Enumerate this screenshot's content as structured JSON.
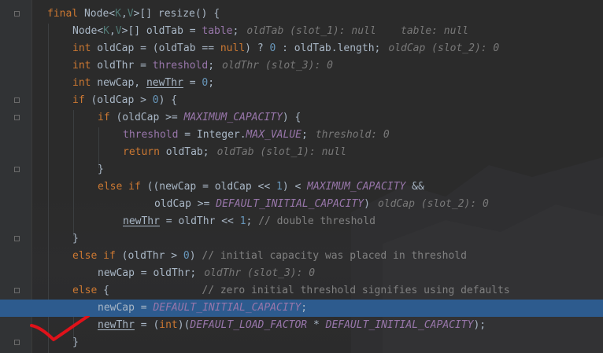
{
  "code_lines": [
    {
      "text": "final Node<K,V>[] resize() {"
    },
    {
      "text": "Node<K,V>[] oldTab = table;",
      "hint": "oldTab (slot_1): null    table: null"
    },
    {
      "text": "int oldCap = (oldTab == null) ? 0 : oldTab.length;",
      "hint": "oldCap (slot_2): 0"
    },
    {
      "text": "int oldThr = threshold;",
      "hint": "oldThr (slot_3): 0"
    },
    {
      "text": "int newCap, newThr = 0;"
    },
    {
      "text": "if (oldCap > 0) {"
    },
    {
      "text": "if (oldCap >= MAXIMUM_CAPACITY) {"
    },
    {
      "text": "threshold = Integer.MAX_VALUE;",
      "hint": "threshold: 0"
    },
    {
      "text": "return oldTab;",
      "hint": "oldTab (slot_1): null"
    },
    {
      "text": "}"
    },
    {
      "text": "else if ((newCap = oldCap << 1) < MAXIMUM_CAPACITY &&"
    },
    {
      "text": "oldCap >= DEFAULT_INITIAL_CAPACITY)",
      "hint": "oldCap (slot_2): 0"
    },
    {
      "text": "newThr = oldThr << 1; // double threshold"
    },
    {
      "text": "}"
    },
    {
      "text": "else if (oldThr > 0) // initial capacity was placed in threshold"
    },
    {
      "text": "newCap = oldThr;",
      "hint": "oldThr (slot_3): 0"
    },
    {
      "text": "else {               // zero initial threshold signifies using defaults"
    },
    {
      "text": "newCap = DEFAULT_INITIAL_CAPACITY;"
    },
    {
      "text": "newThr = (int)(DEFAULT_LOAD_FACTOR * DEFAULT_INITIAL_CAPACITY);"
    },
    {
      "text": "}"
    }
  ],
  "colors": {
    "background": "#2b2b2b",
    "gutter": "#313335",
    "current_line": "#2d5b8e",
    "keyword": "#cc7832",
    "field": "#9876aa",
    "number": "#6897bb",
    "comment": "#808080",
    "inline_hint": "#787878",
    "annotation_mark": "#e0121a"
  },
  "annotation": {
    "icon": "red-checkmark"
  }
}
